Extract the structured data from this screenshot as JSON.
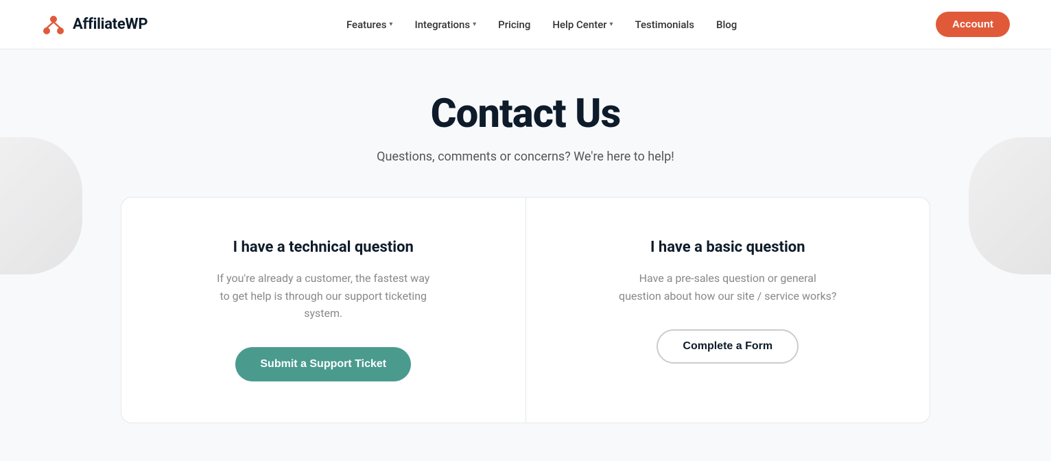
{
  "brand": {
    "name": "AffiliateWP",
    "logo_color": "#e05a3a"
  },
  "nav": {
    "links": [
      {
        "label": "Features",
        "has_dropdown": true
      },
      {
        "label": "Integrations",
        "has_dropdown": true
      },
      {
        "label": "Pricing",
        "has_dropdown": false
      },
      {
        "label": "Help Center",
        "has_dropdown": true
      },
      {
        "label": "Testimonials",
        "has_dropdown": false
      },
      {
        "label": "Blog",
        "has_dropdown": false
      }
    ],
    "account_button": "Account"
  },
  "page": {
    "title": "Contact Us",
    "subtitle": "Questions, comments or concerns? We're here to help!"
  },
  "panels": [
    {
      "id": "technical",
      "title": "I have a technical question",
      "description": "If you're already a customer, the fastest way to get help is through our support ticketing system.",
      "button_label": "Submit a Support Ticket",
      "button_type": "primary"
    },
    {
      "id": "basic",
      "title": "I have a basic question",
      "description": "Have a pre-sales question or general question about how our site / service works?",
      "button_label": "Complete a Form",
      "button_type": "secondary"
    }
  ]
}
